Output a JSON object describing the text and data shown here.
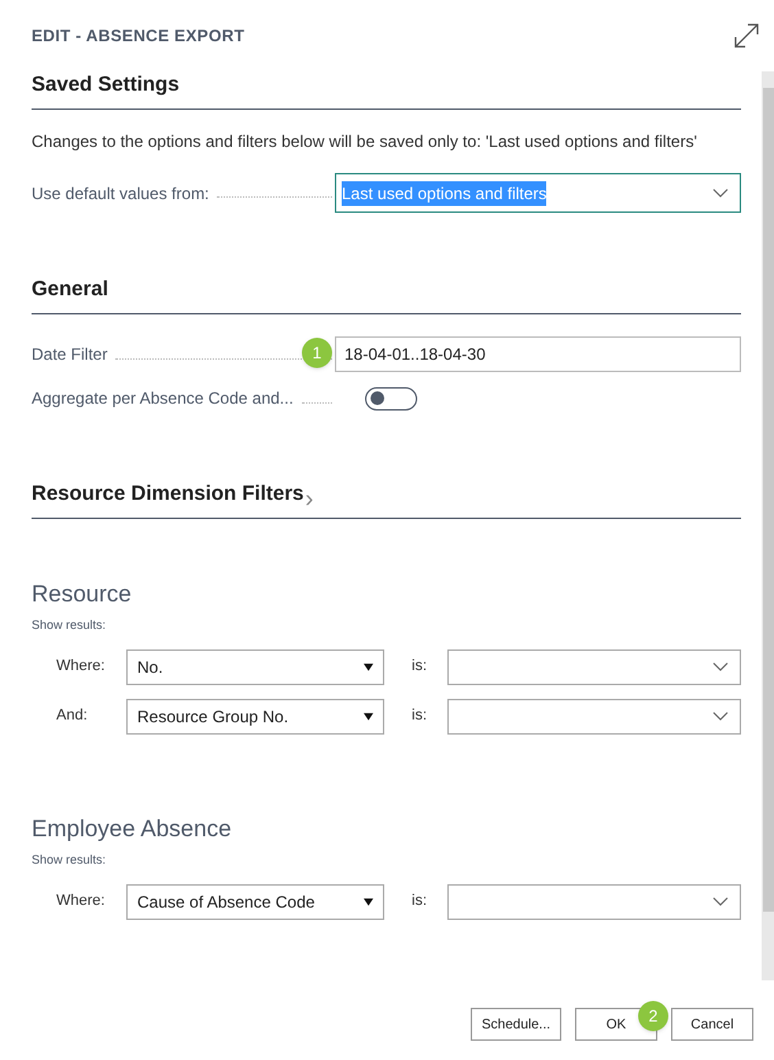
{
  "window": {
    "title": "EDIT - ABSENCE EXPORT"
  },
  "saved_settings": {
    "heading": "Saved Settings",
    "note": "Changes to the options and filters below will be saved only to: 'Last used options and filters'",
    "label": "Use default values from:",
    "value": "Last used options and filters",
    "value_selected": true
  },
  "general": {
    "heading": "General",
    "fields": [
      {
        "kind": "text",
        "label": "Date Filter",
        "value": "18-04-01..18-04-30",
        "badge": "1"
      },
      {
        "kind": "toggle",
        "label": "Aggregate per Absence Code and...",
        "on": false
      }
    ]
  },
  "dimension_filters": {
    "heading": "Resource Dimension Filters",
    "chevron": "›"
  },
  "filter_groups": [
    {
      "title": "Resource",
      "subtitle": "Show results:",
      "rows": [
        {
          "connector": "Where:",
          "field": "No.",
          "operator": "is:"
        },
        {
          "connector": "And:",
          "field": "Resource Group No.",
          "operator": "is:"
        }
      ]
    },
    {
      "title": "Employee Absence",
      "subtitle": "Show results:",
      "rows": [
        {
          "connector": "Where:",
          "field": "Cause of Absence Code",
          "operator": "is:"
        }
      ]
    }
  ],
  "buttons": [
    {
      "label": "Schedule..."
    },
    {
      "label": "OK",
      "badge": "2"
    },
    {
      "label": "Cancel"
    }
  ]
}
